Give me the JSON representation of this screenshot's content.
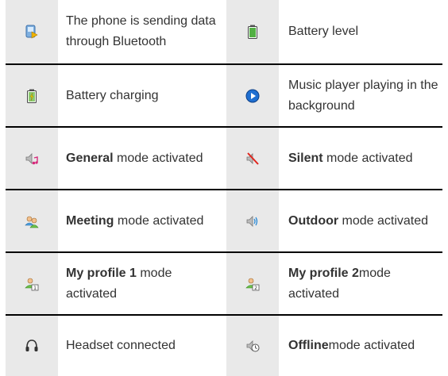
{
  "rows": [
    {
      "left": {
        "icon": "bluetooth-sending-icon",
        "bold": "",
        "text": "The phone is sending data through Bluetooth"
      },
      "right": {
        "icon": "battery-level-icon",
        "bold": "",
        "text": "Battery level"
      }
    },
    {
      "left": {
        "icon": "battery-charging-icon",
        "bold": "",
        "text": "Battery charging"
      },
      "right": {
        "icon": "music-player-icon",
        "bold": "",
        "text": "Music player playing in the background"
      }
    },
    {
      "left": {
        "icon": "general-mode-icon",
        "bold": "General",
        "text": " mode activated"
      },
      "right": {
        "icon": "silent-mode-icon",
        "bold": "Silent",
        "text": " mode activated"
      }
    },
    {
      "left": {
        "icon": "meeting-mode-icon",
        "bold": "Meeting",
        "text": " mode activated"
      },
      "right": {
        "icon": "outdoor-mode-icon",
        "bold": "Outdoor",
        "text": " mode activated"
      }
    },
    {
      "left": {
        "icon": "my-profile-1-icon",
        "bold": "My profile 1",
        "text": " mode activated"
      },
      "right": {
        "icon": "my-profile-2-icon",
        "bold": "My profile 2",
        "text": "mode activated"
      }
    },
    {
      "left": {
        "icon": "headset-icon",
        "bold": "",
        "text": "Headset connected"
      },
      "right": {
        "icon": "offline-mode-icon",
        "bold": "Offline",
        "text": "mode activated"
      }
    }
  ]
}
